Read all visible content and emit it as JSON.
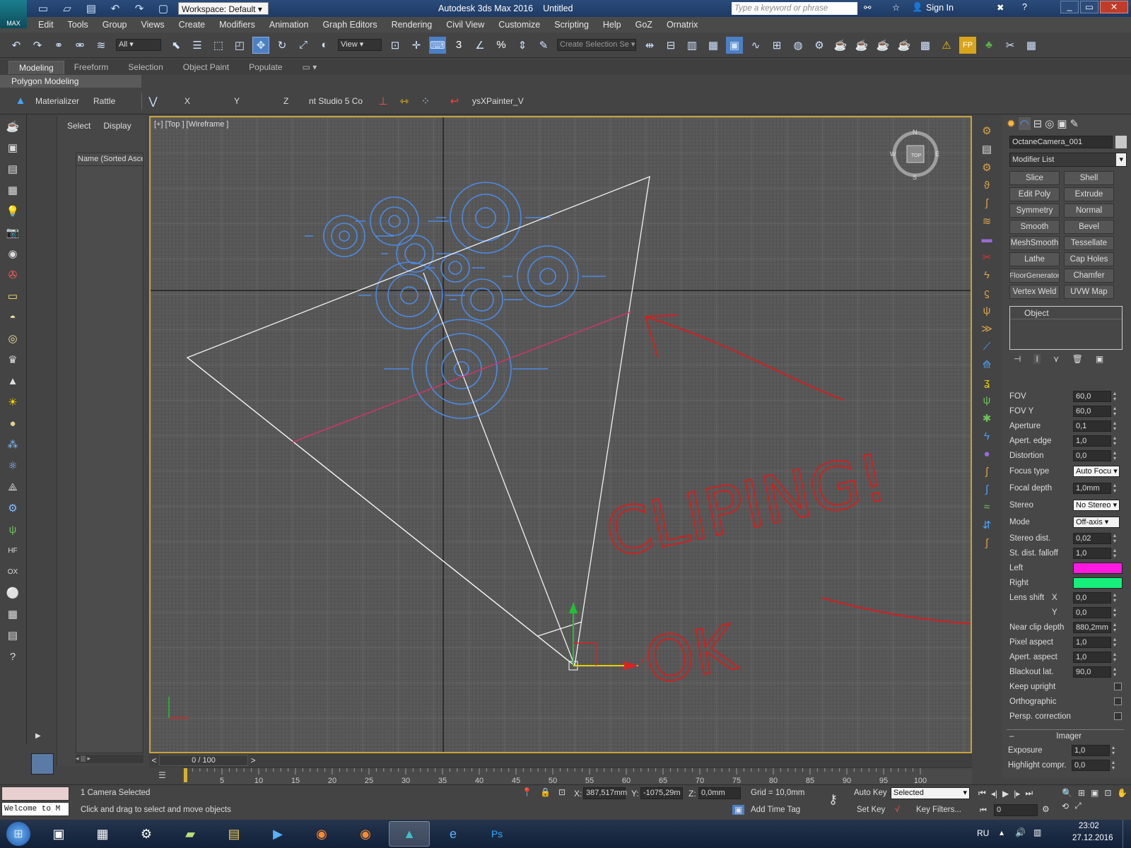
{
  "title_bar": {
    "logo": "MAX",
    "workspace": "Workspace: Default",
    "app_title": "Autodesk 3ds Max 2016",
    "doc_title": "Untitled",
    "search_placeholder": "Type a keyword or phrase",
    "sign_in": "Sign In"
  },
  "menu": [
    "Edit",
    "Tools",
    "Group",
    "Views",
    "Create",
    "Modifiers",
    "Animation",
    "Graph Editors",
    "Rendering",
    "Civil View",
    "Customize",
    "Scripting",
    "Help",
    "GoZ",
    "Ornatrix"
  ],
  "main_toolbar": {
    "filter": "All",
    "ref_coord": "View",
    "selection_set_placeholder": "Create Selection Se",
    "snap_labels": [
      "3",
      "%"
    ]
  },
  "ribbon": {
    "tabs": [
      "Modeling",
      "Freeform",
      "Selection",
      "Object Paint",
      "Populate"
    ],
    "active_tab": "Modeling",
    "sub_label": "Polygon Modeling",
    "items": [
      "Materializer",
      "Rattle",
      "X",
      "Y",
      "Z",
      "nt Studio 5 Co",
      "ysXPainter_V"
    ]
  },
  "scene_explorer": {
    "tabs": [
      "Select",
      "Display"
    ],
    "column": "Name (Sorted Ascer"
  },
  "viewport": {
    "label": "[+] [Top ] [Wireframe ]",
    "viewcube_face": "TOP",
    "compass": [
      "N",
      "E",
      "S",
      "W"
    ],
    "axis_x": "x",
    "annotation_clipping": "CLIPING!",
    "annotation_ok": "OK",
    "annotation_color": "#d21f1f"
  },
  "command_panel": {
    "object_name": "OctaneCamera_001",
    "modifier_list": "Modifier List",
    "modifiers": [
      "Slice",
      "Shell",
      "Edit Poly",
      "Extrude",
      "Symmetry",
      "Normal",
      "Smooth",
      "Bevel",
      "MeshSmooth",
      "Tessellate",
      "Lathe",
      "Cap Holes",
      "FloorGenerator",
      "Chamfer",
      "Vertex Weld",
      "UVW Map"
    ],
    "stack_item": "Object",
    "params": [
      {
        "label": "FOV",
        "value": "60,0"
      },
      {
        "label": "FOV Y",
        "value": "60,0"
      },
      {
        "label": "Aperture",
        "value": "0,1"
      },
      {
        "label": "Apert. edge",
        "value": "1,0"
      },
      {
        "label": "Distortion",
        "value": "0,0"
      }
    ],
    "focus_type": {
      "label": "Focus type",
      "value": "Auto Focu"
    },
    "focal_depth": {
      "label": "Focal depth",
      "value": "1,0mm"
    },
    "stereo": {
      "label": "Stereo",
      "value": "No Stereo"
    },
    "mode": {
      "label": "Mode",
      "value": "Off-axis"
    },
    "stereo_params": [
      {
        "label": "Stereo dist.",
        "value": "0,02"
      },
      {
        "label": "St. dist. falloff",
        "value": "1,0"
      }
    ],
    "left": {
      "label": "Left",
      "color": "#ff19e0"
    },
    "right": {
      "label": "Right",
      "color": "#16f07a"
    },
    "lens_shift": {
      "label": "Lens shift",
      "x_label": "X",
      "x": "0,0",
      "y_label": "Y",
      "y": "0,0"
    },
    "params2": [
      {
        "label": "Near clip depth",
        "value": "880,2mm"
      },
      {
        "label": "Pixel aspect",
        "value": "1,0"
      },
      {
        "label": "Apert. aspect",
        "value": "1,0"
      },
      {
        "label": "Blackout lat.",
        "value": "90,0"
      }
    ],
    "checks": [
      "Keep upright",
      "Orthographic",
      "Persp. correction"
    ],
    "imager": {
      "title": "Imager",
      "exposure_label": "Exposure",
      "exposure": "1,0",
      "highlight_label": "Highlight compr.",
      "highlight": "0,0"
    }
  },
  "timeline": {
    "frame": "0 / 100",
    "ticks": [
      "5",
      "10",
      "15",
      "20",
      "25",
      "30",
      "35",
      "40",
      "45",
      "50",
      "55",
      "60",
      "65",
      "70",
      "75",
      "80",
      "85",
      "90",
      "95",
      "100"
    ]
  },
  "status_bar": {
    "maxscript": "Welcome to M",
    "selection": "1 Camera Selected",
    "prompt": "Click and drag to select and move objects",
    "x_label": "X:",
    "x": "387,517mm",
    "y_label": "Y:",
    "y": "-1075,29m",
    "z_label": "Z:",
    "z": "0,0mm",
    "grid": "Grid = 10,0mm",
    "add_time_tag": "Add Time Tag",
    "auto_key": "Auto Key",
    "set_key": "Set Key",
    "selected": "Selected",
    "key_filters": "Key Filters...",
    "frame_field": "0"
  },
  "taskbar": {
    "lang": "RU",
    "time": "23:02",
    "date": "27.12.2016"
  }
}
